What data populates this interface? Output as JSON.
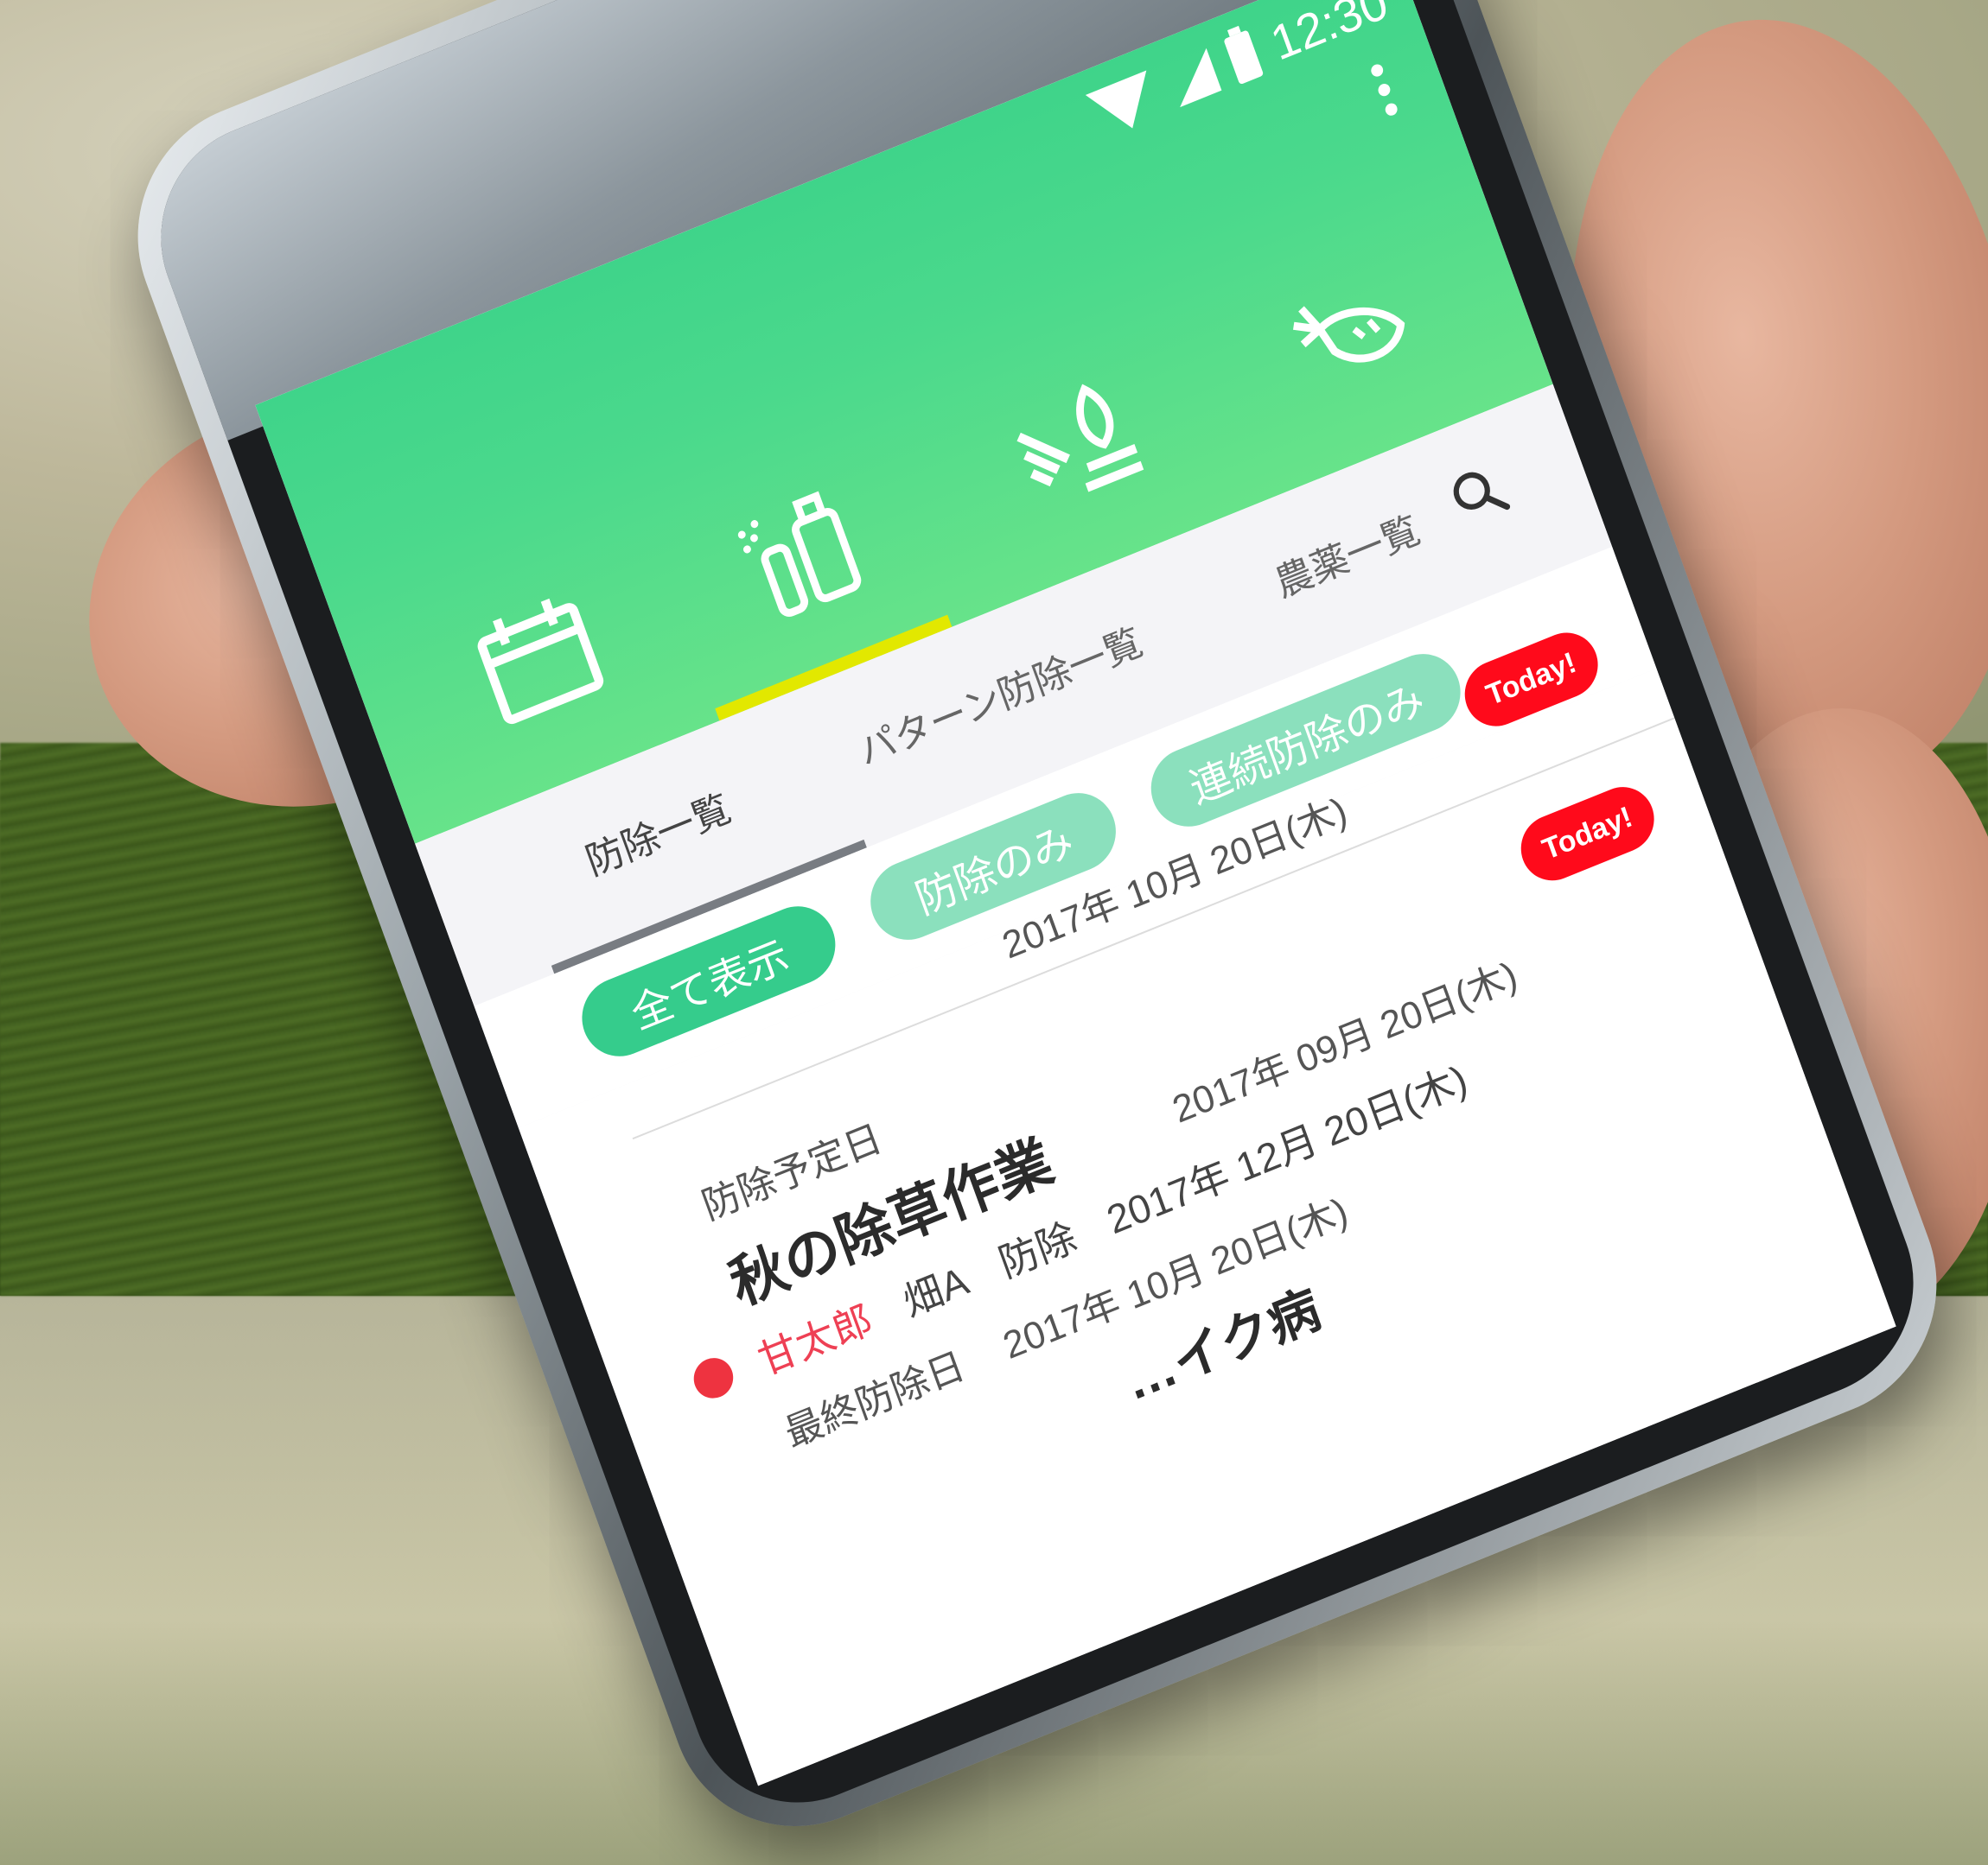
{
  "status": {
    "time": "12:30"
  },
  "header": {
    "tabs": [
      {
        "name": "calendar"
      },
      {
        "name": "spray"
      },
      {
        "name": "field"
      },
      {
        "name": "carrot"
      }
    ]
  },
  "subtabs": {
    "items": [
      "防除一覧",
      "パターン防除一覧",
      "農薬一覧"
    ]
  },
  "filters": {
    "all": "全て表示",
    "only": "防除のみ",
    "continuous": "連続防除のみ"
  },
  "list": {
    "items": [
      {
        "badge": "Today!",
        "date_label": "",
        "date_value": "2017年 10月 20日(木)",
        "title": "",
        "tags": []
      },
      {
        "badge": "Today!",
        "date_label": "防除予定日",
        "date_value": "2017年 09月 20日(木)",
        "title": "秋の除草作業",
        "person": "甘太郎",
        "tags": [
          "畑A",
          "防除"
        ],
        "dates": [
          {
            "label": "最終防除日",
            "value": "2017年 12月 20日(木)"
          },
          {
            "label": "",
            "value": "2017年 10月 20日(木)"
          }
        ],
        "next_title": "…イク病"
      }
    ]
  },
  "colors": {
    "primary": "#3fd48a",
    "accent_indicator": "#e2e800",
    "badge": "#ff0a1b",
    "chip_active": "#35cc8c",
    "chip_muted": "#8be0bd"
  }
}
